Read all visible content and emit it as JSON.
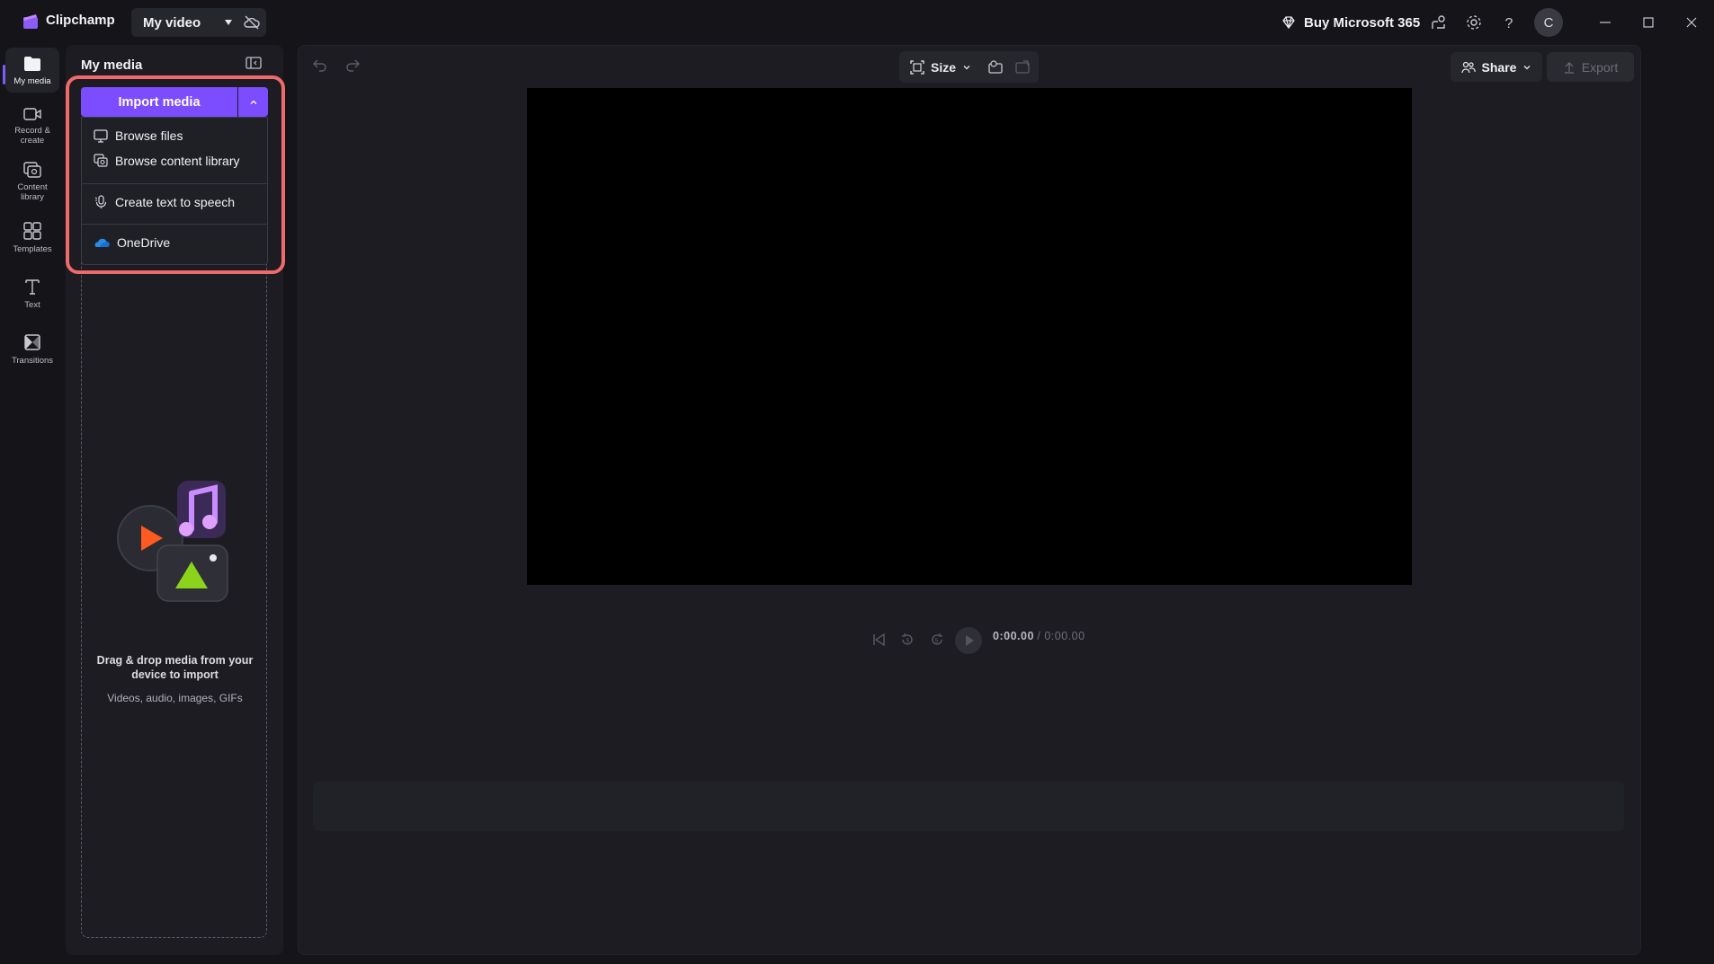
{
  "app": {
    "name": "Clipchamp",
    "project_name": "My video"
  },
  "header": {
    "buy_label": "Buy Microsoft 365",
    "avatar_initial": "C"
  },
  "rail": {
    "items": [
      {
        "label": "My media",
        "icon": "folder-icon"
      },
      {
        "label": "Record & create",
        "icon": "video-camera-icon"
      },
      {
        "label": "Content library",
        "icon": "content-library-icon"
      },
      {
        "label": "Templates",
        "icon": "templates-icon"
      },
      {
        "label": "Text",
        "icon": "text-icon"
      },
      {
        "label": "Transitions",
        "icon": "transitions-icon"
      }
    ],
    "active": "My media"
  },
  "media_panel": {
    "title": "My media",
    "import_label": "Import media",
    "menu": [
      {
        "label": "Browse files",
        "icon": "monitor-icon"
      },
      {
        "label": "Browse content library",
        "icon": "content-library-icon"
      },
      {
        "label": "Create text to speech",
        "icon": "microphone-icon"
      },
      {
        "label": "OneDrive",
        "icon": "onedrive-cloud-icon"
      }
    ],
    "dropzone_title": "Drag & drop media from your device to import",
    "dropzone_sub": "Videos, audio, images, GIFs"
  },
  "toolbar": {
    "size_label": "Size",
    "share_label": "Share",
    "export_label": "Export"
  },
  "player": {
    "current_time": "0:00.00",
    "total_time": "/ 0:00.00"
  },
  "colors": {
    "accent": "#7c4dff",
    "highlight": "#ef6a6a",
    "background": "#141419",
    "panel": "#1c1c22"
  }
}
